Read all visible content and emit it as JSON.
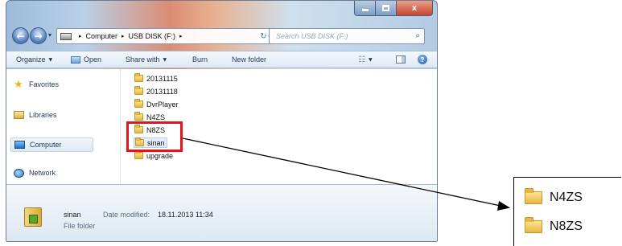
{
  "address": {
    "segments": [
      "Computer",
      "USB DISK (F:)"
    ],
    "search_placeholder": "Search USB DISK (F:)"
  },
  "toolbar": {
    "organize": "Organize",
    "open": "Open",
    "share_with": "Share with",
    "burn": "Burn",
    "new_folder": "New folder"
  },
  "nav": {
    "favorites": "Favorites",
    "libraries": "Libraries",
    "computer": "Computer",
    "network": "Network"
  },
  "files": [
    {
      "name": "20131115"
    },
    {
      "name": "20131118"
    },
    {
      "name": "DvrPlayer"
    },
    {
      "name": "N4ZS"
    },
    {
      "name": "N8ZS"
    },
    {
      "name": "sinan"
    },
    {
      "name": "upgrade"
    }
  ],
  "details": {
    "name": "sinan",
    "type": "File folder",
    "date_label": "Date modified:",
    "date_value": "18.11.2013 11:34"
  },
  "zoom": {
    "items": [
      "N4ZS",
      "N8ZS"
    ]
  },
  "colors": {
    "highlight": "#e3141b",
    "folder": "#e4b74a",
    "selected_row": "#e3edf8"
  }
}
